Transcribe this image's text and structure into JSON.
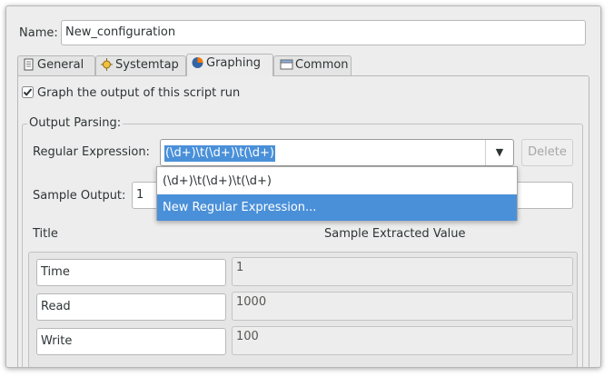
{
  "name_field": {
    "label": "Name:",
    "value": "New_configuration"
  },
  "tabs": [
    {
      "label": "General",
      "icon": "document-icon"
    },
    {
      "label": "Systemtap",
      "icon": "systemtap-icon"
    },
    {
      "label": "Graphing",
      "icon": "graphing-icon",
      "active": true
    },
    {
      "label": "Common",
      "icon": "window-icon"
    }
  ],
  "graph_checkbox": {
    "label": "Graph the output of this script run",
    "checked": true
  },
  "output_parsing": {
    "title": "Output Parsing:",
    "regex_label": "Regular Expression:",
    "regex_value": "(\\d+)\\t(\\d+)\\t(\\d+)",
    "delete_label": "Delete",
    "sample_label": "Sample Output:",
    "sample_value": "1",
    "dropdown_items": [
      "(\\d+)\\t(\\d+)\\t(\\d+)",
      "New Regular Expression..."
    ],
    "title_header": "Title",
    "value_header": "Sample Extracted Value",
    "rows": [
      {
        "title": "Time",
        "value": "1"
      },
      {
        "title": "Read",
        "value": "1000"
      },
      {
        "title": "Write",
        "value": "100"
      }
    ]
  },
  "colors": {
    "selection": "#4a90d9",
    "window_bg": "#ededed"
  }
}
